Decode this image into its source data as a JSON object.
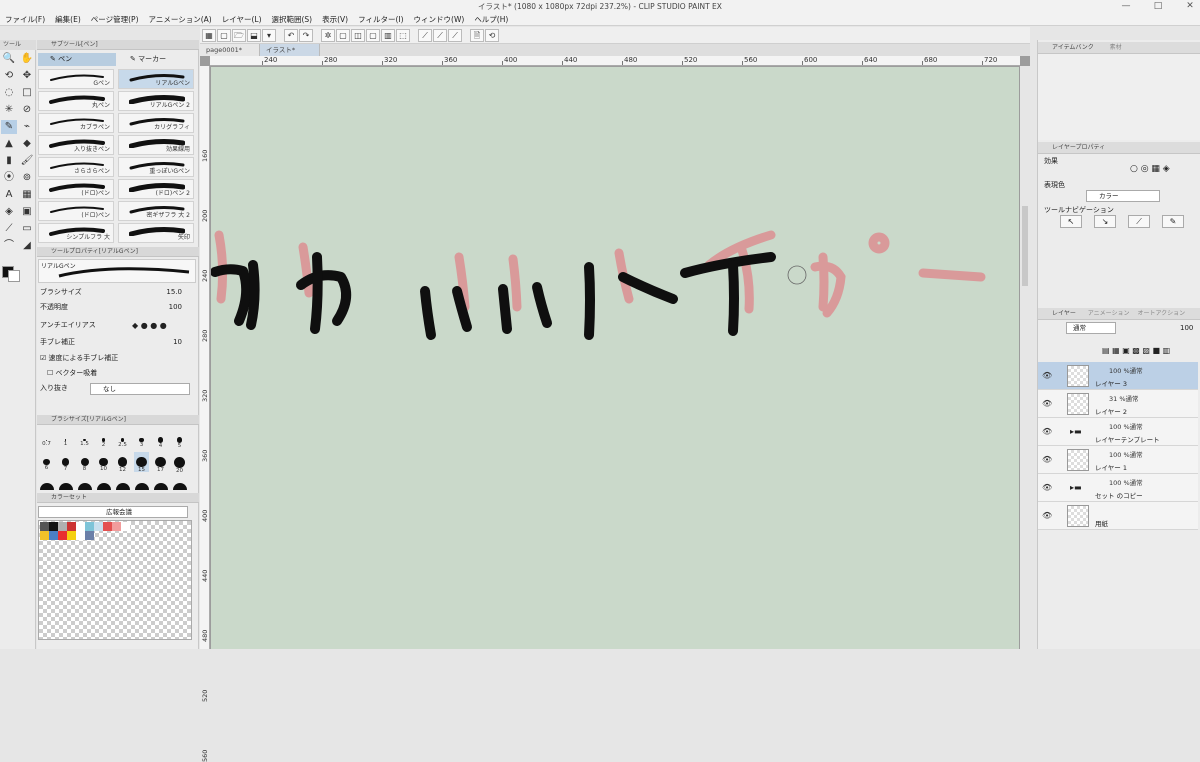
{
  "app": {
    "title": "イラスト* (1080 x 1080px 72dpi 237.2%) - CLIP STUDIO PAINT EX",
    "menu": [
      "ファイル(F)",
      "編集(E)",
      "ページ管理(P)",
      "アニメーション(A)",
      "レイヤー(L)",
      "選択範囲(S)",
      "表示(V)",
      "フィルター(I)",
      "ウィンドウ(W)",
      "ヘルプ(H)"
    ],
    "window_controls": [
      "—",
      "□",
      "✕"
    ]
  },
  "command_bar": {
    "buttons": [
      "▦",
      "▢",
      "🗁",
      "⬓",
      "▾",
      "↶",
      "↷",
      "✲",
      "▢",
      "◫",
      "▢",
      "▥",
      "⬚",
      "⟋",
      "⟋",
      "⟋",
      "🗎",
      "⟲"
    ]
  },
  "tool_panel": {
    "header": "ツール",
    "tools": [
      "🔍",
      "✋",
      "⟲",
      "✥",
      "◌",
      "□",
      "✳",
      "⊘",
      "✎",
      "⌁",
      "▲",
      "◆",
      "▮",
      "🖌",
      "⦿",
      "⊚",
      "A",
      "▦",
      "◈",
      "▣",
      "⟋",
      "▭",
      "⌒",
      "◢"
    ],
    "main_color": "#111111",
    "sub_color": "#ffffff"
  },
  "sub_tool_panel": {
    "header": "サブツール[ペン]",
    "tabs": [
      "ペン",
      "マーカー"
    ],
    "brushes": [
      "Gペン",
      "リアルGペン",
      "丸ペン",
      "リアルGペン 2",
      "カブラペン",
      "カリグラフィ",
      "入り抜きペン",
      "効果線用",
      "さらさらペン",
      "重っぽいGペン",
      "(ドロ)ペン",
      "(ドロ)ペン 2",
      "(ドロ)ペン",
      "密ギザフラ 大 2",
      "シンプルフラ 大",
      "矢印"
    ]
  },
  "tool_property": {
    "header": "ツールプロパティ[リアルGペン]",
    "preset_name": "リアルGペン",
    "brush_size_label": "ブラシサイズ",
    "brush_size_value": "15.0",
    "opacity_label": "不透明度",
    "opacity_value": "100",
    "antialias_label": "アンチエイリアス",
    "stabilization_label": "手ブレ補正",
    "stabilization_value": "10",
    "speed_stab_label": "速度による手ブレ補正",
    "vector_snap_label": "ベクター吸着",
    "taper_label": "入り抜き",
    "taper_value": "なし"
  },
  "brush_size_panel": {
    "header": "ブラシサイズ[リアルGペン]",
    "sizes": [
      "0.7",
      "1",
      "1.5",
      "2",
      "2.5",
      "3",
      "4",
      "5",
      "6",
      "7",
      "8",
      "10",
      "12",
      "15",
      "17",
      "20"
    ]
  },
  "color_set": {
    "header": "カラーセット",
    "name": "広報会議",
    "swatches": [
      "#555555",
      "#111111",
      "#b0b0b0",
      "#c33",
      "#ffffff",
      "#7ec4d8",
      "#c9e0ee",
      "#e45050",
      "#f29c9c",
      "#ffffff",
      "#f2c228",
      "#4a7fc4",
      "#e83030",
      "#f5d010",
      "#ffffff",
      "#6a7fa8"
    ]
  },
  "document": {
    "tabs": [
      "page0001*",
      "イラスト*"
    ],
    "h_ruler": [
      "240",
      "280",
      "320",
      "360",
      "400",
      "440",
      "480",
      "520",
      "560",
      "600",
      "640",
      "680",
      "720"
    ],
    "v_ruler": [
      "160",
      "200",
      "240",
      "280",
      "320",
      "360",
      "400",
      "440",
      "480",
      "520",
      "560"
    ]
  },
  "canvas": {
    "background": "#cad9ca",
    "ink_color": "#0f0f0f",
    "sketch_color": "#d99a9a"
  },
  "item_bank": {
    "header": "アイテムバンク",
    "tab2": "素材"
  },
  "layer_property": {
    "header": "レイヤープロパティ",
    "effect_label": "効果",
    "expression_label": "表現色",
    "expression_value": "カラー",
    "tool_nav_label": "ツールナビゲーション"
  },
  "layers": {
    "header": "レイヤー",
    "tab2": "アニメーション",
    "tab3": "オートアクション",
    "blend_mode": "通常",
    "opacity": "100",
    "items": [
      {
        "mode": "100 %通常",
        "name": "レイヤー 3"
      },
      {
        "mode": "31 %通常",
        "name": "レイヤー 2"
      },
      {
        "mode": "100 %通常",
        "name": "レイヤーテンプレート"
      },
      {
        "mode": "100 %通常",
        "name": "レイヤー 1"
      },
      {
        "mode": "100 %通常",
        "name": "セット のコピー"
      },
      {
        "mode": "",
        "name": "用紙"
      }
    ]
  }
}
